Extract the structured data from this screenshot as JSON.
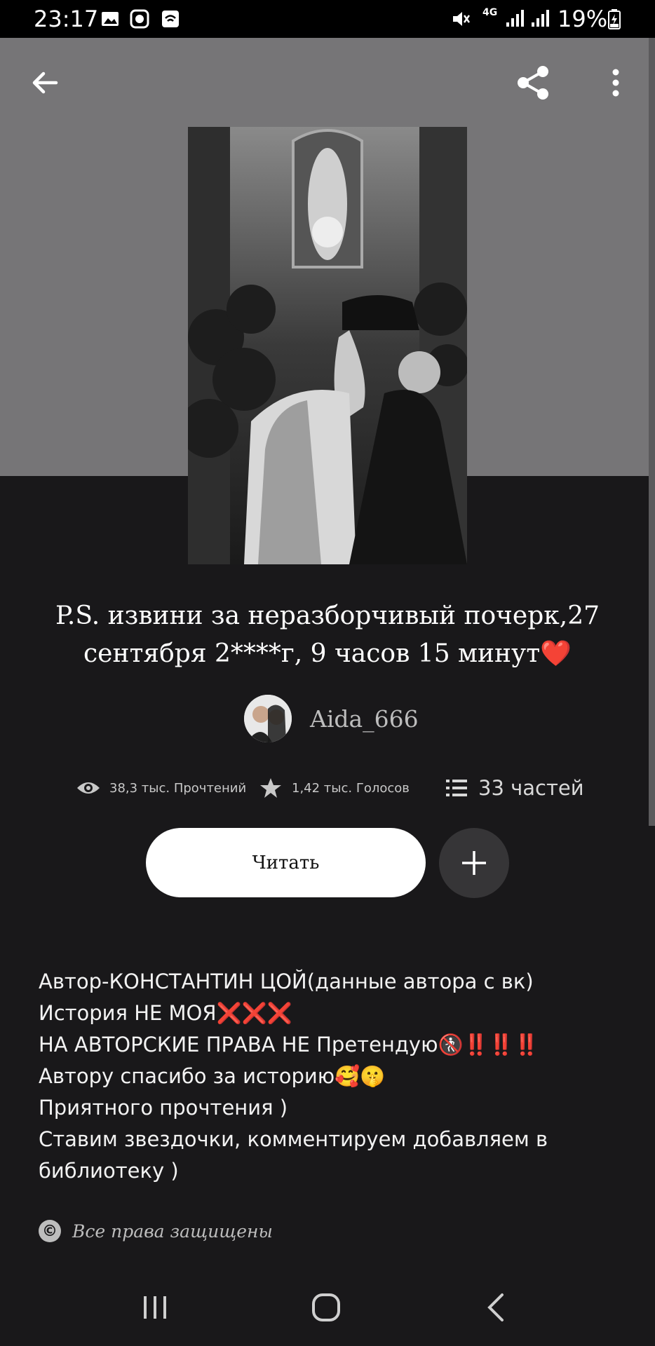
{
  "status_bar": {
    "time": "23:17",
    "battery_percent": "19%",
    "network": "4G"
  },
  "header": {
    "back_icon": "arrow-left-icon",
    "share_icon": "share-icon",
    "more_icon": "more-vertical-icon"
  },
  "story": {
    "title": "P.S. извини за неразборчивый почерк,27 сентября 2****г, 9 часов 15 минут",
    "title_emoji": "❤️",
    "author": "Aida_666",
    "reads": "38,3 тыс. Прочтений",
    "votes": "1,42 тыс. Голосов",
    "parts": "33 частей"
  },
  "actions": {
    "read_label": "Читать",
    "add_icon": "plus-icon"
  },
  "description": {
    "line1": "Автор-КОНСТАНТИН ЦОЙ(данные автора с вк)",
    "line2": "История НЕ МОЯ",
    "line2_emoji": "❌❌❌",
    "line3": "НА АВТОРСКИЕ ПРАВА НЕ Претендую",
    "line3_emoji": "🚷‼️‼️‼️",
    "line4": "Автору спасибо за историю",
    "line4_emoji": "🥰🤫",
    "line5": "Приятного прочтения )",
    "line6": "Ставим звездочки, комментируем добавляем в библиотеку )"
  },
  "copyright": {
    "label": "Все права защищены"
  },
  "colors": {
    "background": "#19181a",
    "header": "#767577",
    "accent_red": "#e0202b"
  }
}
